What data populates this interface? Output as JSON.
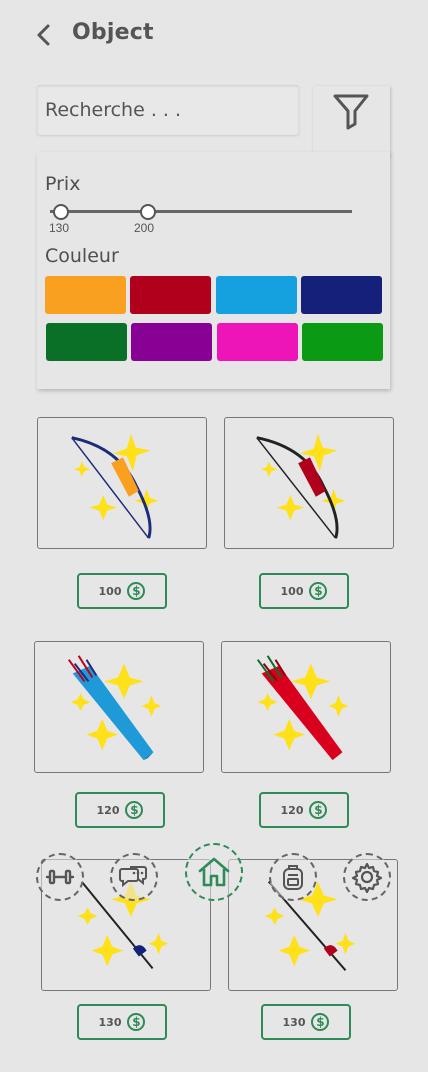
{
  "header": {
    "title": "Object",
    "back_icon": "chevron-left-icon"
  },
  "search": {
    "placeholder": "Recherche . . ."
  },
  "filter": {
    "icon": "filter-icon",
    "price_label": "Prix",
    "price_min": "130",
    "price_max": "200",
    "color_label": "Couleur",
    "colors": [
      "#f9a020",
      "#b0001c",
      "#15a0e0",
      "#14207a",
      "#0a7028",
      "#880094",
      "#ee15b8",
      "#0a9a14"
    ]
  },
  "products": [
    {
      "name": "orange-bow",
      "price": "100"
    },
    {
      "name": "red-bow",
      "price": "100"
    },
    {
      "name": "blue-quiver",
      "price": "120"
    },
    {
      "name": "red-quiver",
      "price": "120"
    },
    {
      "name": "blue-sword",
      "price": "130"
    },
    {
      "name": "red-sword",
      "price": "130"
    }
  ],
  "currency_icon": "dollar-coin-icon",
  "nav": [
    "dumbbell-icon",
    "chat-icon",
    "home-icon",
    "backpack-icon",
    "gear-icon"
  ]
}
